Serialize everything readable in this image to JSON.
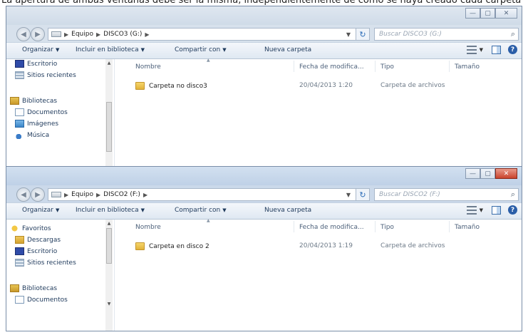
{
  "caption": "La apertura de ambas ventanas debe ser la misma, independientemente de cómo se haya creado cada carpeta",
  "window_top": {
    "caption_buttons": [
      "—",
      "▢",
      "✕"
    ],
    "address": [
      "Equipo",
      "DISCO3 (G:)"
    ],
    "search_placeholder": "Buscar DISCO3 (G:)",
    "toolbar": {
      "organize": "Organizar",
      "include": "Incluir en biblioteca",
      "share": "Compartir con",
      "new_folder": "Nueva carpeta"
    },
    "nav_items": [
      "Escritorio",
      "Sitios recientes",
      "Bibliotecas",
      "Documentos",
      "Imágenes",
      "Música"
    ],
    "columns": {
      "name": "Nombre",
      "date": "Fecha de modifica...",
      "type": "Tipo",
      "size": "Tamaño"
    },
    "files": [
      {
        "name": "Carpeta no disco3",
        "date": "20/04/2013 1:20",
        "type": "Carpeta de archivos"
      }
    ]
  },
  "window_bottom": {
    "caption_buttons": [
      "—",
      "▢",
      "✕"
    ],
    "address": [
      "Equipo",
      "DISCO2 (F:)"
    ],
    "search_placeholder": "Buscar DISCO2 (F:)",
    "toolbar": {
      "organize": "Organizar",
      "include": "Incluir en biblioteca",
      "share": "Compartir con",
      "new_folder": "Nueva carpeta"
    },
    "nav_items": [
      "Favoritos",
      "Descargas",
      "Escritorio",
      "Sitios recientes",
      "Bibliotecas",
      "Documentos"
    ],
    "columns": {
      "name": "Nombre",
      "date": "Fecha de modifica...",
      "type": "Tipo",
      "size": "Tamaño"
    },
    "files": [
      {
        "name": "Carpeta en disco 2",
        "date": "20/04/2013 1:19",
        "type": "Carpeta de archivos"
      }
    ]
  },
  "colors": {
    "window_frame": "#7a8ea8",
    "toolbar_text": "#1e395b",
    "close_button_active": "#c9432c"
  }
}
